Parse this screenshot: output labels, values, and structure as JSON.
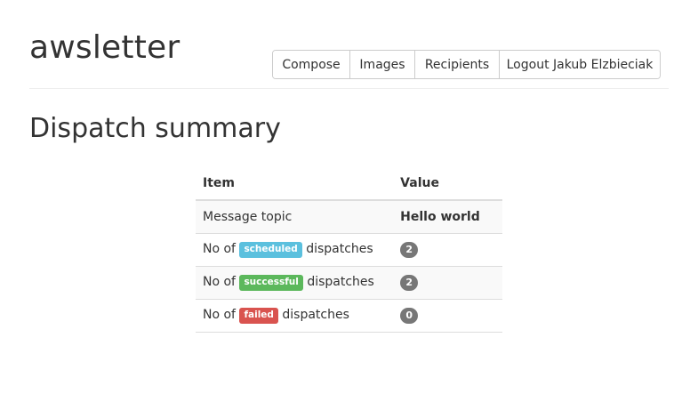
{
  "header": {
    "brand": "awsletter",
    "nav": {
      "compose": "Compose",
      "images": "Images",
      "recipients": "Recipients",
      "logout": "Logout Jakub Elzbieciak"
    }
  },
  "main": {
    "title": "Dispatch summary",
    "table": {
      "headers": {
        "item": "Item",
        "value": "Value"
      },
      "rows": [
        {
          "item": "Message topic",
          "value": "Hello world"
        },
        {
          "prefix": "No of",
          "label": "scheduled",
          "suffix": "dispatches",
          "value": "2"
        },
        {
          "prefix": "No of",
          "label": "successful",
          "suffix": "dispatches",
          "value": "2"
        },
        {
          "prefix": "No of",
          "label": "failed",
          "suffix": "dispatches",
          "value": "0"
        }
      ]
    }
  },
  "colors": {
    "scheduled": "#5bc0de",
    "successful": "#5cb85c",
    "failed": "#d9534f",
    "badge": "#777777"
  }
}
